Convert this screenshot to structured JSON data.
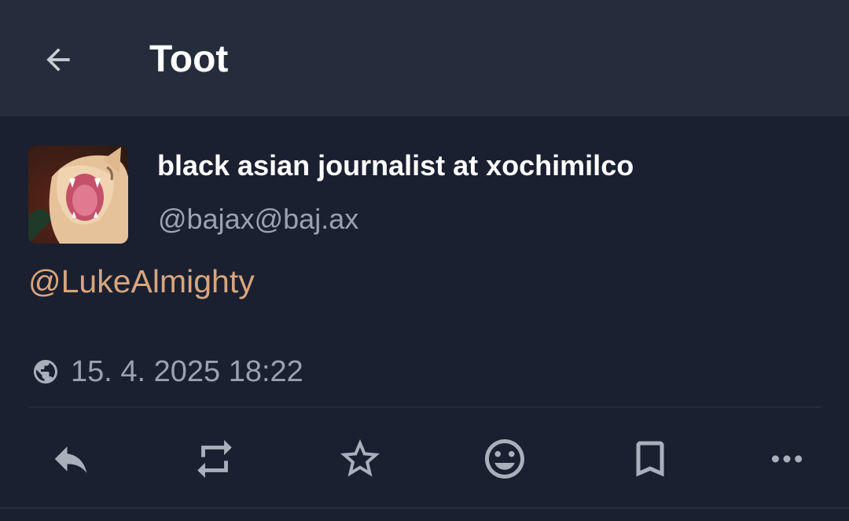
{
  "header": {
    "back_icon": "arrow-left-icon",
    "title": "Toot"
  },
  "status": {
    "author": {
      "display_name": "black asian journalist at xochimilco",
      "handle": "@bajax@baj.ax",
      "avatar": "cat-yawning-avatar"
    },
    "content": {
      "mention": "@LukeAlmighty"
    },
    "visibility_icon": "globe-icon",
    "timestamp": "15. 4. 2025 18:22"
  },
  "actions": [
    {
      "name": "reply",
      "icon": "reply-icon"
    },
    {
      "name": "boost",
      "icon": "repeat-icon"
    },
    {
      "name": "favourite",
      "icon": "star-icon"
    },
    {
      "name": "react",
      "icon": "emoji-icon"
    },
    {
      "name": "bookmark",
      "icon": "bookmark-icon"
    },
    {
      "name": "more",
      "icon": "more-horizontal-icon"
    }
  ],
  "colors": {
    "background": "#1a2030",
    "topbar": "#252d3d",
    "text_primary": "#ffffff",
    "text_secondary": "#9aa2b0",
    "mention": "#d9a57c",
    "icon": "#a9b0bc"
  }
}
